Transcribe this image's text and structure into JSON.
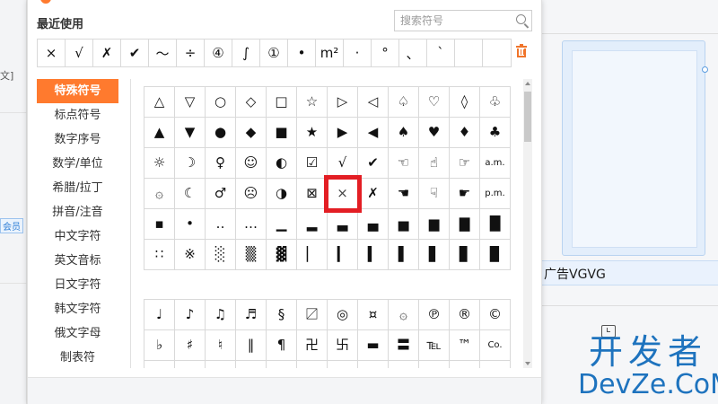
{
  "background": {
    "left_fragments": [
      "文]",
      "会员"
    ],
    "ad_text": "广告VGVG",
    "watermark_cn": "开发者",
    "watermark_en": "DevZe.CoM"
  },
  "popup": {
    "recent_label": "最近使用",
    "search_placeholder": "搜索符号",
    "recent": [
      "×",
      "√",
      "✗",
      "✔",
      "～",
      "÷",
      "④",
      "∫",
      "①",
      "•",
      "m²",
      "·",
      "°",
      "、",
      "ˋ",
      "",
      ""
    ],
    "categories": [
      {
        "label": "特殊符号",
        "active": true
      },
      {
        "label": "标点符号",
        "active": false
      },
      {
        "label": "数字序号",
        "active": false
      },
      {
        "label": "数学/单位",
        "active": false
      },
      {
        "label": "希腊/拉丁",
        "active": false
      },
      {
        "label": "拼音/注音",
        "active": false
      },
      {
        "label": "中文字符",
        "active": false
      },
      {
        "label": "英文音标",
        "active": false
      },
      {
        "label": "日文字符",
        "active": false
      },
      {
        "label": "韩文字符",
        "active": false
      },
      {
        "label": "俄文字母",
        "active": false
      },
      {
        "label": "制表符",
        "active": false
      }
    ],
    "grid_a": [
      [
        "△",
        "▽",
        "○",
        "◇",
        "□",
        "☆",
        "▷",
        "◁",
        "♤",
        "♡",
        "◊",
        "♧"
      ],
      [
        "▲",
        "▼",
        "●",
        "◆",
        "■",
        "★",
        "▶",
        "◀",
        "♠",
        "♥",
        "♦",
        "♣"
      ],
      [
        "☼",
        "☽",
        "♀",
        "☺",
        "◐",
        "☑",
        "√",
        "✔",
        "☜",
        "☝",
        "☞",
        "a.m."
      ],
      [
        "۞",
        "☾",
        "♂",
        "☹",
        "◑",
        "⊠",
        "×",
        "✗",
        "☚",
        "☟",
        "☛",
        "p.m."
      ],
      [
        "▪",
        "•",
        "‥",
        "…",
        "▁",
        "▂",
        "▃",
        "▄",
        "▅",
        "▆",
        "▇",
        "█"
      ],
      [
        "∷",
        "※",
        "░",
        "▒",
        "▓",
        "▏",
        "▎",
        "▍",
        "▌",
        "▋",
        "▊",
        "▉"
      ]
    ],
    "grid_a_selected": "3.6",
    "grid_b": [
      [
        "♩",
        "♪",
        "♫",
        "♬",
        "§",
        "〼",
        "◎",
        "¤",
        "۞",
        "℗",
        "®",
        "©"
      ],
      [
        "♭",
        "♯",
        "♮",
        "‖",
        "¶",
        "卍",
        "卐",
        "▬",
        "〓",
        "℡",
        "™",
        "Co."
      ],
      [
        "",
        "",
        "",
        "",
        "",
        "",
        "",
        "",
        "",
        "",
        "",
        ""
      ]
    ],
    "colors": {
      "accent": "#ff7a2e",
      "selection": "#e31e24",
      "watermark": "#1e73be"
    }
  }
}
